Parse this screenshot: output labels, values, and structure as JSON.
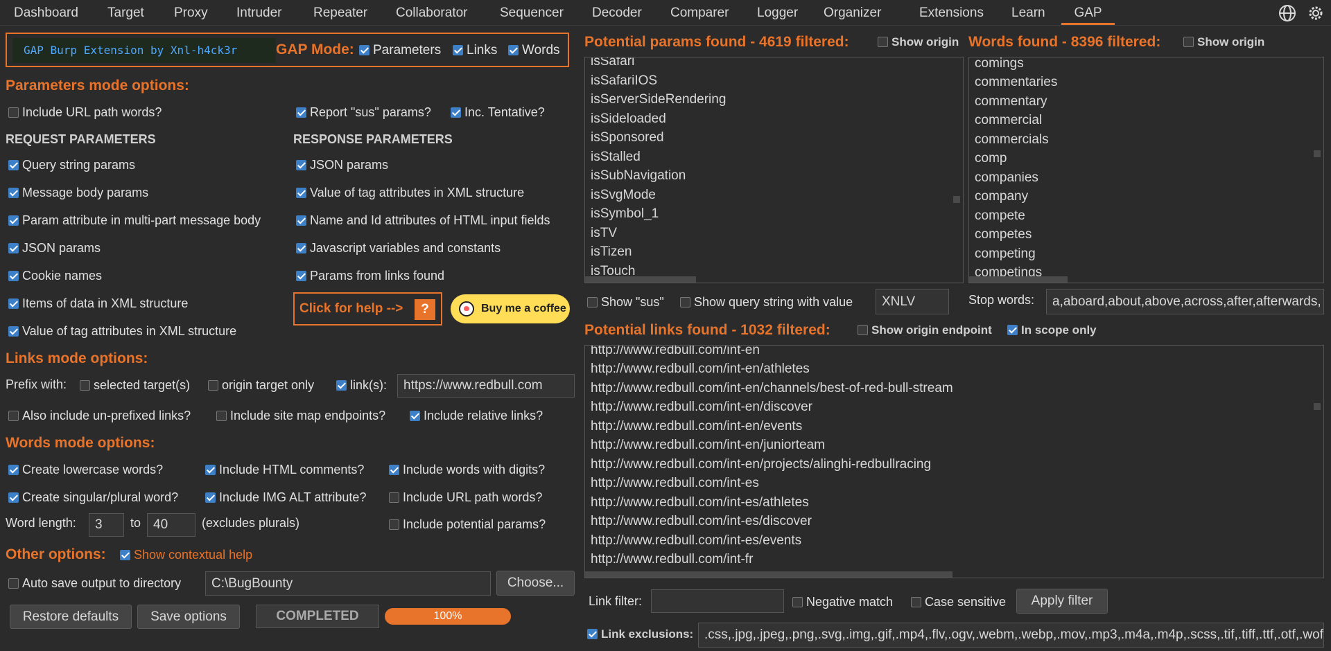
{
  "menu": {
    "items": [
      "Dashboard",
      "Target",
      "Proxy",
      "Intruder",
      "Repeater",
      "Collaborator",
      "Sequencer",
      "Decoder",
      "Comparer",
      "Logger",
      "Organizer",
      "Extensions",
      "Learn",
      "GAP"
    ],
    "active": "GAP",
    "icons": [
      "globe-icon",
      "gear-icon"
    ]
  },
  "banner": {
    "logo_text": "GAP Burp Extension by Xnl-h4ck3r",
    "mode_label": "GAP Mode:",
    "modes": [
      {
        "label": "Parameters",
        "checked": true
      },
      {
        "label": "Links",
        "checked": true
      },
      {
        "label": "Words",
        "checked": true
      }
    ]
  },
  "params_opts": {
    "title": "Parameters mode options:",
    "include_url_path": {
      "label": "Include URL path words?",
      "checked": false
    },
    "report_sus": {
      "label": "Report \"sus\" params?",
      "checked": true
    },
    "inc_tentative": {
      "label": "Inc. Tentative?",
      "checked": true
    },
    "request_title": "REQUEST PARAMETERS",
    "response_title": "RESPONSE PARAMETERS",
    "request": [
      {
        "label": "Query string params",
        "checked": true
      },
      {
        "label": "Message body params",
        "checked": true
      },
      {
        "label": "Param attribute in multi-part message body",
        "checked": true
      },
      {
        "label": "JSON params",
        "checked": true
      },
      {
        "label": "Cookie names",
        "checked": true
      },
      {
        "label": "Items of data in XML structure",
        "checked": true
      },
      {
        "label": "Value of tag attributes in XML structure",
        "checked": true
      }
    ],
    "response": [
      {
        "label": "JSON params",
        "checked": true
      },
      {
        "label": "Value of tag attributes in XML structure",
        "checked": true
      },
      {
        "label": "Name and Id attributes of HTML input fields",
        "checked": true
      },
      {
        "label": "Javascript variables and constants",
        "checked": true
      },
      {
        "label": "Params from links found",
        "checked": true
      }
    ],
    "help_label": "Click for help -->",
    "help_q": "?",
    "coffee_label": "Buy me a coffee"
  },
  "links_opts": {
    "title": "Links mode options:",
    "prefix_label": "Prefix with:",
    "selected_targets": {
      "label": "selected target(s)",
      "checked": false
    },
    "origin_only": {
      "label": "origin target only",
      "checked": false
    },
    "links": {
      "label": "link(s):",
      "checked": true
    },
    "prefix_value": "https://www.redbull.com",
    "unprefixed": {
      "label": "Also include un-prefixed links?",
      "checked": false
    },
    "sitemap": {
      "label": "Include site map endpoints?",
      "checked": false
    },
    "relative": {
      "label": "Include relative links?",
      "checked": true
    }
  },
  "words_opts": {
    "title": "Words mode options:",
    "lowercase": {
      "label": "Create lowercase words?",
      "checked": true
    },
    "html_comments": {
      "label": "Include HTML comments?",
      "checked": true
    },
    "with_digits": {
      "label": "Include words with digits?",
      "checked": true
    },
    "singular_plural": {
      "label": "Create singular/plural word?",
      "checked": true
    },
    "img_alt": {
      "label": "Include IMG ALT attribute?",
      "checked": true
    },
    "url_path": {
      "label": "Include URL path words?",
      "checked": false
    },
    "length_label": "Word length:",
    "min": "3",
    "to": "to",
    "max": "40",
    "excludes": "(excludes plurals)",
    "potential_params": {
      "label": "Include potential params?",
      "checked": false
    }
  },
  "other_opts": {
    "title": "Other options:",
    "contextual_help": {
      "label": "Show contextual help",
      "checked": true
    },
    "autosave": {
      "label": "Auto save output to directory",
      "checked": false
    },
    "directory": "C:\\BugBounty",
    "choose": "Choose...",
    "restore": "Restore defaults",
    "save": "Save options",
    "status": "COMPLETED",
    "progress_percent": 100,
    "progress_label": "100%"
  },
  "params_panel": {
    "title": "Potential params found - 4619 filtered:",
    "show_origin": {
      "label": "Show origin",
      "checked": false
    },
    "items": [
      "isSafari",
      "isSafariIOS",
      "isServerSideRendering",
      "isSideloaded",
      "isSponsored",
      "isStalled",
      "isSubNavigation",
      "isSvgMode",
      "isSymbol_1",
      "isTV",
      "isTizen",
      "isTouch"
    ],
    "show_sus": {
      "label": "Show \"sus\"",
      "checked": false
    },
    "show_query": {
      "label": "Show query string with value",
      "checked": false
    },
    "query_value": "XNLV"
  },
  "words_panel": {
    "title": "Words found - 8396 filtered:",
    "show_origin": {
      "label": "Show origin",
      "checked": false
    },
    "items": [
      "comings",
      "commentaries",
      "commentary",
      "commercial",
      "commercials",
      "comp",
      "companies",
      "company",
      "compete",
      "competes",
      "competing",
      "competings"
    ],
    "stop_label": "Stop words:",
    "stop_value": "a,aboard,about,above,across,after,afterwards,"
  },
  "links_panel": {
    "title": "Potential links found - 1032 filtered:",
    "show_origin_endpoint": {
      "label": "Show origin endpoint",
      "checked": false
    },
    "in_scope": {
      "label": "In scope only",
      "checked": true
    },
    "items": [
      "http://www.redbull.com/int-en",
      "http://www.redbull.com/int-en/athletes",
      "http://www.redbull.com/int-en/channels/best-of-red-bull-stream",
      "http://www.redbull.com/int-en/discover",
      "http://www.redbull.com/int-en/events",
      "http://www.redbull.com/int-en/juniorteam",
      "http://www.redbull.com/int-en/projects/alinghi-redbullracing",
      "http://www.redbull.com/int-es",
      "http://www.redbull.com/int-es/athletes",
      "http://www.redbull.com/int-es/discover",
      "http://www.redbull.com/int-es/events",
      "http://www.redbull.com/int-fr"
    ],
    "filter_label": "Link filter:",
    "filter_value": "",
    "negative": {
      "label": "Negative match",
      "checked": false
    },
    "case_sensitive": {
      "label": "Case sensitive",
      "checked": false
    },
    "apply": "Apply filter",
    "exclusions": {
      "label": "Link exclusions:",
      "checked": true
    },
    "exclusions_value": ".css,.jpg,.jpeg,.png,.svg,.img,.gif,.mp4,.flv,.ogv,.webm,.webp,.mov,.mp3,.m4a,.m4p,.scss,.tif,.tiff,.ttf,.otf,.woff,"
  },
  "colors": {
    "accent": "#e8732a",
    "checkbox": "#3d80c8",
    "background": "#2b2b2b"
  }
}
